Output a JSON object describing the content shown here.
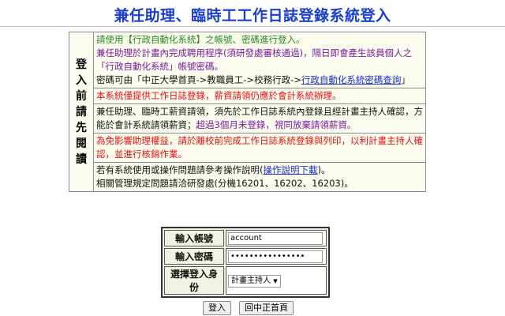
{
  "title": "兼任助理、臨時工工作日誌登錄系統登入",
  "notice": {
    "side_chars": [
      "登",
      "入",
      "前",
      "請",
      "先",
      "閱",
      "讀"
    ],
    "row1": {
      "line1": "請使用【行政自動化系統】之帳號、密碼進行登入。",
      "line2": "兼任助理於計畫內完成聘用程序(須研發處審核通過)，隔日即會產生該員個人之「行政自動化系統」帳號密碼。",
      "line3_prefix": "密碼可由「中正大學首頁->教職員工->校務行政->",
      "line3_link": "行政自動化系統密碼查詢",
      "line3_suffix": "」"
    },
    "row2": "本系統僅提供工作日誌登錄，薪資請領仍應於會計系統辦理。",
    "row3": {
      "text": "兼任助理、臨時工薪資請領，須先於工作日誌系統內登錄且經計畫主持人確認，方能於會計系統請領薪資；",
      "text_purple": "超過3個月未登錄，視同放棄請領薪資。"
    },
    "row4": "為免影響助理權益，請於離校前完成工作日誌系統登錄與列印，以利計畫主持人確認，並進行核銷作業。",
    "row5": {
      "line1_prefix": "若有系統使用或操作問題請參考操作說明(",
      "line1_link": "操作說明下載",
      "line1_suffix": ")。",
      "line2": "相關管理規定問題請洽研發處(分機16201、16202、16203)。"
    }
  },
  "login": {
    "account_label": "輸入帳號",
    "account_value": "account",
    "password_label": "輸入密碼",
    "password_value": "••••••••••••••••",
    "role_label": "選擇登入身份",
    "role_selected": "計畫主持人",
    "role_arrow": "▼"
  },
  "buttons": {
    "login": "登入",
    "home": "回中正首頁"
  },
  "colors": {
    "title": "#1a3fd0",
    "green": "#238a23",
    "purple": "#7a1a9e",
    "red": "#e01010",
    "link": "#1a2fc8"
  }
}
